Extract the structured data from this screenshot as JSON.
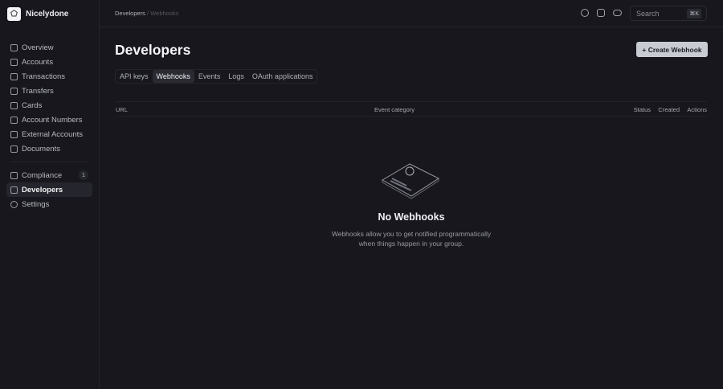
{
  "brand": {
    "name": "Nicelydone"
  },
  "sidebar": {
    "items": [
      {
        "label": "Overview"
      },
      {
        "label": "Accounts"
      },
      {
        "label": "Transactions"
      },
      {
        "label": "Transfers"
      },
      {
        "label": "Cards"
      },
      {
        "label": "Account Numbers"
      },
      {
        "label": "External Accounts"
      },
      {
        "label": "Documents"
      }
    ],
    "secondary": [
      {
        "label": "Compliance",
        "badge": "1"
      },
      {
        "label": "Developers"
      },
      {
        "label": "Settings"
      }
    ]
  },
  "breadcrumb": {
    "parent": "Developers",
    "sep": "/",
    "current": "Webhooks"
  },
  "search": {
    "placeholder": "Search",
    "shortcut": "⌘K"
  },
  "page": {
    "title": "Developers",
    "create_label": "+ Create Webhook"
  },
  "tabs": [
    "API keys",
    "Webhooks",
    "Events",
    "Logs",
    "OAuth applications"
  ],
  "table": {
    "columns": [
      "URL",
      "Event category",
      "Status",
      "Created",
      "Actions"
    ]
  },
  "empty": {
    "title": "No Webhooks",
    "line1": "Webhooks allow you to get notified programmatically",
    "line2": "when things happen in your group."
  }
}
